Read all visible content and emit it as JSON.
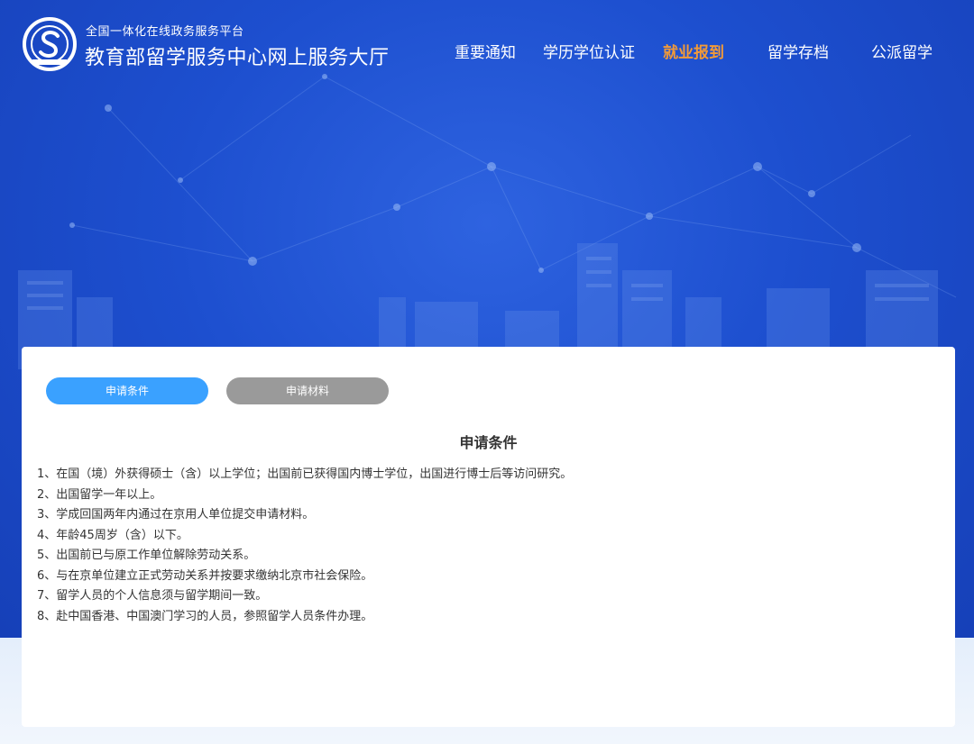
{
  "header": {
    "platform_subtitle": "全国一体化在线政务服务平台",
    "platform_title": "教育部留学服务中心网上服务大厅",
    "logo_icon": "cscse-logo-icon"
  },
  "nav": {
    "items": [
      {
        "label": "重要通知",
        "active": false
      },
      {
        "label": "学历学位认证",
        "active": false
      },
      {
        "label": "就业报到",
        "active": true
      },
      {
        "label": "留学存档",
        "active": false
      },
      {
        "label": "公派留学",
        "active": false
      }
    ]
  },
  "tabs": {
    "conditions_label": "申请条件",
    "materials_label": "申请材料"
  },
  "content": {
    "title": "申请条件",
    "items": [
      "1、在国（境）外获得硕士（含）以上学位；出国前已获得国内博士学位，出国进行博士后等访问研究。",
      "2、出国留学一年以上。",
      "3、学成回国两年内通过在京用人单位提交申请材料。",
      "4、年龄45周岁（含）以下。",
      "5、出国前已与原工作单位解除劳动关系。",
      "6、与在京单位建立正式劳动关系并按要求缴纳北京市社会保险。",
      "7、留学人员的个人信息须与留学期间一致。",
      "8、赴中国香港、中国澳门学习的人员，参照留学人员条件办理。"
    ]
  },
  "colors": {
    "hero_blue": "#1d4fcf",
    "nav_active": "#f29a38",
    "tab_active": "#3aa1ff",
    "tab_inactive": "#9a9a9a",
    "text": "#333333"
  }
}
